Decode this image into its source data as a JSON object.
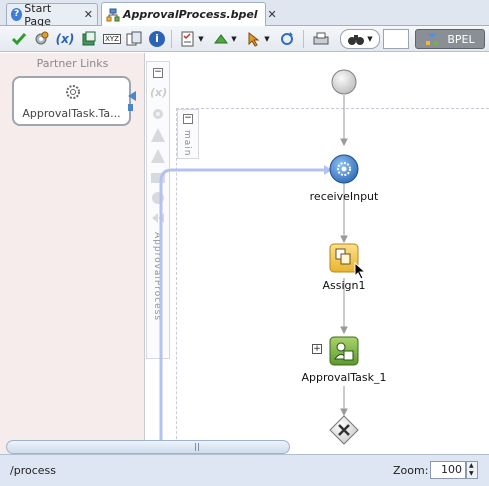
{
  "tabs": [
    {
      "label": "Start Page",
      "icon": "help-icon"
    },
    {
      "label": "ApprovalProcess.bpel",
      "icon": "bpel-process-icon"
    }
  ],
  "toolbar": {
    "bpel_label": "BPEL",
    "search_value": ""
  },
  "partner_links": {
    "title": "Partner Links",
    "items": [
      {
        "label": "ApprovalTask.Ta..."
      }
    ]
  },
  "side_labels": {
    "main": "main",
    "process": "ApprovalProcess"
  },
  "process": {
    "nodes": [
      {
        "label": "",
        "type": "start"
      },
      {
        "label": "receiveInput",
        "type": "receive"
      },
      {
        "label": "Assign1",
        "type": "assign"
      },
      {
        "label": "ApprovalTask_1",
        "type": "human-task"
      },
      {
        "label": "",
        "type": "end"
      }
    ]
  },
  "status": {
    "path": "/process",
    "zoom_label": "Zoom:",
    "zoom_value": "100"
  },
  "colors": {
    "accent": "#4a86c8",
    "assign": "#f2c84b",
    "human_task": "#7cb342",
    "toolbar_bpel_bg": "#8a8f96"
  }
}
